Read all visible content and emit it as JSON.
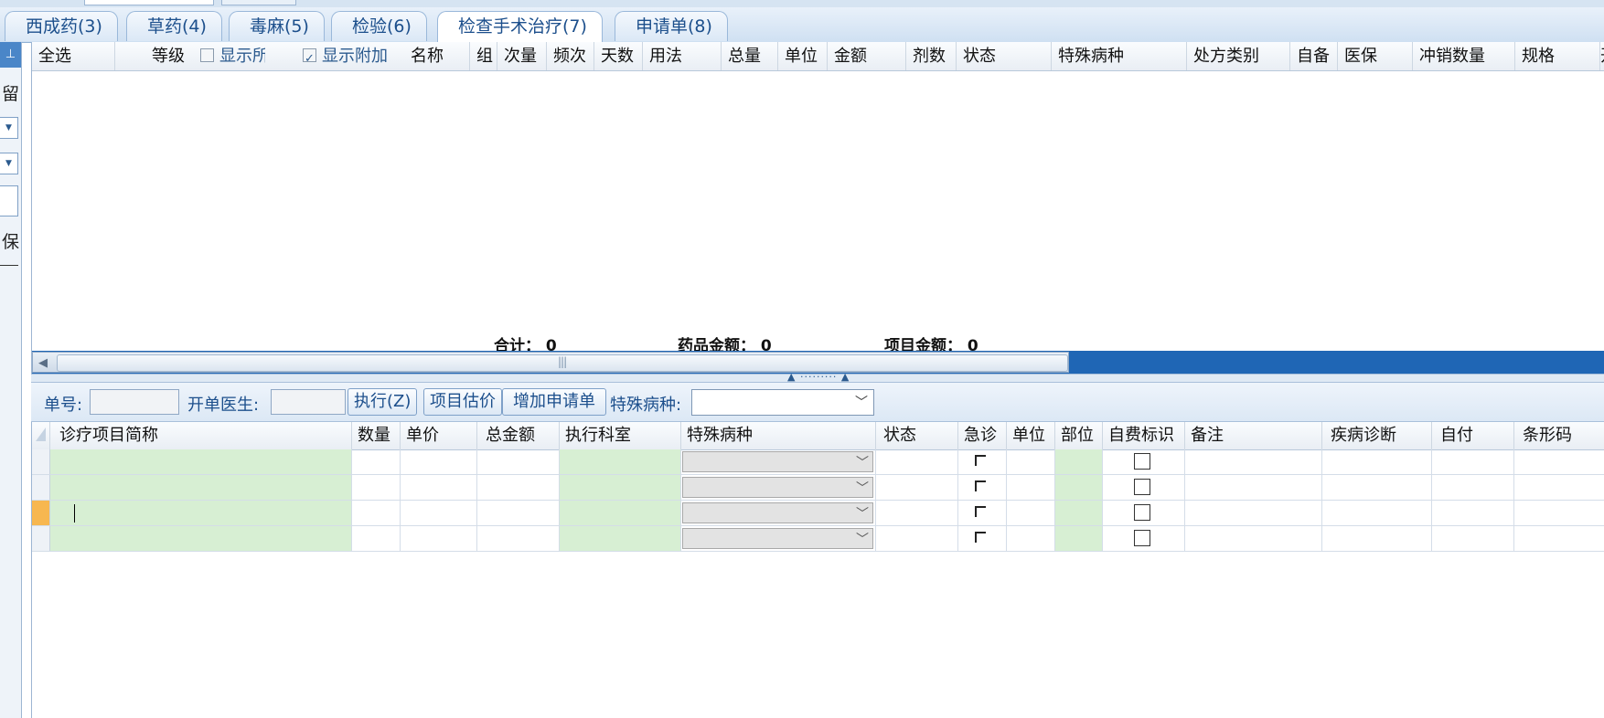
{
  "tabs": [
    {
      "label": "西成药(3)"
    },
    {
      "label": "草药(4)"
    },
    {
      "label": "毒麻(5)"
    },
    {
      "label": "检验(6)"
    },
    {
      "label": "检查手术治疗(7)",
      "active": true
    },
    {
      "label": "申请单(8)"
    }
  ],
  "left_panel": {
    "pin_icon": "pin-icon",
    "char1": "留",
    "char2": "保"
  },
  "upper_grid": {
    "headers": {
      "select_all": "全选",
      "level": "等级",
      "show_all": "显示所有",
      "show_extra": "显示附加",
      "name": "名称",
      "group": "组",
      "dose": "次量",
      "frequency": "频次",
      "days": "天数",
      "usage": "用法",
      "total": "总量",
      "unit": "单位",
      "amount": "金额",
      "doses": "剂数",
      "status": "状态",
      "special_disease": "特殊病种",
      "rx_type": "处方类别",
      "self_prep": "自备",
      "insurance": "医保",
      "offset_qty": "冲销数量",
      "spec": "规格",
      "prescriber_partial": "开单"
    },
    "show_all_checked": false,
    "show_extra_checked": true,
    "totals": {
      "sum": "合计：  0",
      "drug_amount": "药品金额：  0",
      "item_amount": "项目金额：  0"
    }
  },
  "splitter_grip": "▲ ········· ▲",
  "toolbar": {
    "order_no_label": "单号:",
    "order_no_value": "",
    "doctor_label": "开单医生:",
    "doctor_value": "",
    "execute_button": "执行(Z)",
    "estimate_button": "项目估价",
    "add_request_button": "增加申请单",
    "special_disease_label": "特殊病种:",
    "special_disease_value": ""
  },
  "lower_grid": {
    "headers": {
      "item_name": "诊疗项目简称",
      "quantity": "数量",
      "unit_price": "单价",
      "total_amount": "总金额",
      "exec_dept": "执行科室",
      "special_disease": "特殊病种",
      "status": "状态",
      "urgent": "急诊",
      "unit": "单位",
      "body_part": "部位",
      "self_pay_flag": "自费标识",
      "remark": "备注",
      "diagnosis": "疾病诊断",
      "self_pay": "自付",
      "barcode": "条形码"
    },
    "rows": [
      {
        "selected": false
      },
      {
        "selected": false
      },
      {
        "selected": true
      },
      {
        "selected": false
      }
    ]
  },
  "colors": {
    "tab_text": "#1c4f8c",
    "required_cell": "#d7efd3",
    "selected_row_header": "#f7b750",
    "scrollbar_track": "#1f66b5"
  }
}
